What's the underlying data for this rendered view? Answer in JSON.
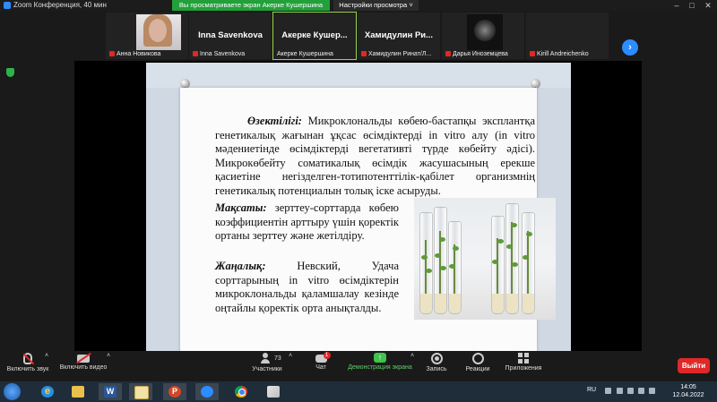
{
  "window": {
    "title": "Zoom Конференция, 40 мин",
    "share_banner": "Вы просматриваете экран Акерке Кушершина",
    "view_options": "Настройки просмотра",
    "controls": [
      "–",
      "□",
      "✕"
    ]
  },
  "participants": [
    {
      "display": "",
      "name": "Анна Новикова",
      "muted": true,
      "video": "photo"
    },
    {
      "display": "Inna Savenkova",
      "name": "Inna Savenkova",
      "muted": true,
      "video": "none"
    },
    {
      "display": "Акерке  Кушер...",
      "name": "Акерке Кушершина",
      "muted": false,
      "video": "none",
      "active": true
    },
    {
      "display": "Хамидулин  Ри...",
      "name": "Хамидулин Ринат/Л...",
      "muted": true,
      "video": "none"
    },
    {
      "display": "",
      "name": "Дарья Иноземцева",
      "muted": true,
      "video": "photo"
    },
    {
      "display": "",
      "name": "Kirill Andreichenko",
      "muted": true,
      "video": "none"
    }
  ],
  "slide": {
    "p1_label": "Өзектілігі:",
    "p1_text": " Микроклональды көбею-бастапқы эксплантқа генетикалық жағынан ұқсас өсімдіктерді in vitro алу (in vitro мәдениетінде өсімдіктерді вегетативті түрде көбейту әдісі). Микрокөбейту соматикалық өсімдік жасушасының ерекше қасиетіне негізделген-тотипотенттілік-қабілет организмнің генетикалық потенциалын толық іске асыруды.",
    "p2_label": "Мақсаты:",
    "p2_text": " зерттеу-сорттарда көбею коэффициентін арттыру үшін қоректік ортаны зерттеу және жетілдіру.",
    "p3_label": "Жаңалық:",
    "p3_text": " Невский, Удача сорттарының in vitro өсімдіктерін микроклональды қаламшалау кезінде оңтайлы қоректік орта анықталды.",
    "corner_mark": "Z"
  },
  "toolbar": {
    "audio": "Включить звук",
    "video": "Включить видео",
    "participants": "Участники",
    "participants_count": "73",
    "chat": "Чат",
    "chat_badge": "1",
    "share": "Демонстрация экрана",
    "record": "Запись",
    "reactions": "Реакции",
    "apps": "Приложения",
    "leave": "Выйти"
  },
  "taskbar": {
    "lang": "RU",
    "time": "14:05",
    "date": "12.04.2022"
  },
  "colors": {
    "zoom_blue": "#2d8cff",
    "share_green": "#22a03a",
    "leave_red": "#e02828"
  }
}
